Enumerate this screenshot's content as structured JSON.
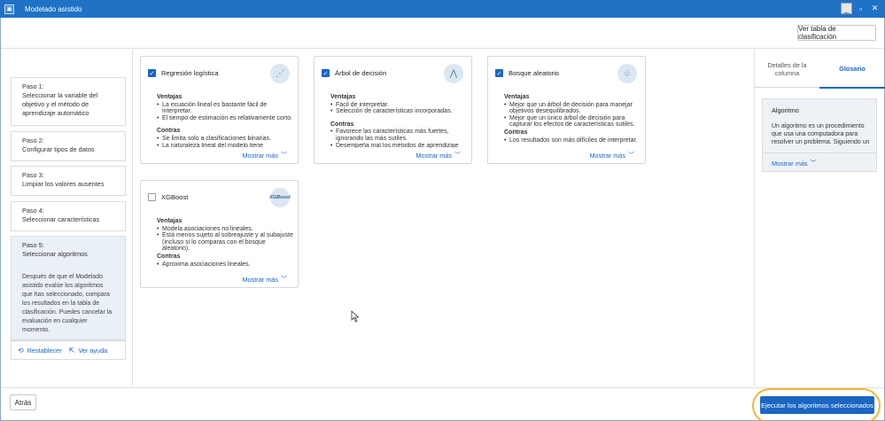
{
  "window": {
    "title": "Modelado asistido",
    "app_icon": "app-icon",
    "controls": [
      "minimize-icon",
      "maximize-icon",
      "close-icon"
    ]
  },
  "toolbar": {
    "ranking_table_label": "Ver tabla de clasificación"
  },
  "steps": [
    {
      "label": "Paso 1:",
      "text": "Seleccionar la variable del objetivo y el método de aprendizaje automático"
    },
    {
      "label": "Paso 2:",
      "text": "Configurar tipos de datos"
    },
    {
      "label": "Paso 3:",
      "text": "Limpiar los valores ausentes"
    },
    {
      "label": "Paso 4:",
      "text": "Seleccionar características"
    },
    {
      "label": "Paso 5:",
      "text": "Seleccionar algoritmos",
      "active": true,
      "description": "Después de que el Modelado asistido evalúe los algoritmos que has seleccionado, compara los resultados en la tabla de clasificación. Puedes cancelar la evaluación en cualquier momento."
    }
  ],
  "step_links": {
    "reset": "Restablecer",
    "help": "Ver ayuda"
  },
  "algorithms": [
    {
      "name": "Regresión logística",
      "checked": true,
      "icon": "logistic-regression-icon",
      "pros_title": "Ventajas",
      "pros": [
        "La ecuación lineal es bastante fácil de interpretar.",
        "El tiempo de estimación es relativamente corto."
      ],
      "cons_title": "Contras",
      "cons": [
        "Se limita solo a clasificaciones binarias.",
        "La naturaleza lineal del modelo tiene"
      ],
      "more": "Mostrar más"
    },
    {
      "name": "Árbol de decisión",
      "checked": true,
      "icon": "decision-tree-icon",
      "pros_title": "Ventajas",
      "pros": [
        "Fácil de interpretar.",
        "Selección de características incorporadas."
      ],
      "cons_title": "Contras",
      "cons": [
        "Favorece las características más fuertes, ignorando las más sutiles.",
        "Desempeña mal los métodos de aprendizaje"
      ],
      "more": "Mostrar más"
    },
    {
      "name": "Bosque aleatorio",
      "checked": true,
      "icon": "random-forest-icon",
      "pros_title": "Ventajas",
      "pros": [
        "Mejor que un árbol de decisión para manejar objetivos desequilibrados.",
        "Mejor que un único árbol de decisión para capturar los efectos de características sutiles."
      ],
      "cons_title": "Contras",
      "cons": [
        "Los resultados son más difíciles de interpretar."
      ],
      "more": "Mostrar más"
    },
    {
      "name": "XGBoost",
      "checked": false,
      "icon": "xgboost-icon",
      "icon_text": "XGBoost",
      "pros_title": "Ventajas",
      "pros": [
        "Modela asociaciones no lineales.",
        "Está menos sujeto al sobreajuste y al subajuste (incluso si lo comparas con el bosque aleatorio)."
      ],
      "cons_title": "Contras",
      "cons": [
        "Aproxima asociaciones lineales."
      ],
      "more": "Mostrar más"
    }
  ],
  "right_panel": {
    "tabs": [
      {
        "label": "Detalles de la columna"
      },
      {
        "label": "Glosario",
        "active": true
      }
    ],
    "glossary": {
      "title": "Algoritmo",
      "text": "Un algoritmo es un procedimiento que usa una computadora para resolver un problema. Siguiendo un",
      "more": "Mostrar más"
    }
  },
  "footer": {
    "back_label": "Atrás",
    "run_label": "Ejecutar los algoritmos seleccionados"
  },
  "colors": {
    "titlebar": "#1f72c4",
    "accent": "#1a66c2",
    "highlight_ring": "#f2b632",
    "active_step": "#eaf0f8"
  }
}
